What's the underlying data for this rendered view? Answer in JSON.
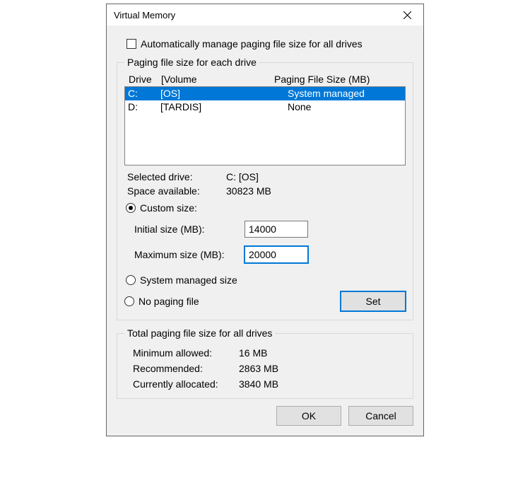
{
  "window": {
    "title": "Virtual Memory"
  },
  "autoManage": {
    "label": "Automatically manage paging file size for all drives",
    "checked": false
  },
  "driveGroup": {
    "legend": "Paging file size for each drive",
    "headers": {
      "drive": "Drive",
      "volume": "[Volume",
      "pfs": "Paging File Size (MB)"
    },
    "rows": [
      {
        "drive": "C:",
        "volume": "[OS]",
        "pfs": "System managed",
        "selected": true
      },
      {
        "drive": "D:",
        "volume": "[TARDIS]",
        "pfs": "None",
        "selected": false
      }
    ],
    "selectedDrive": {
      "label": "Selected drive:",
      "value": "C:  [OS]"
    },
    "spaceAvailable": {
      "label": "Space available:",
      "value": "30823 MB"
    },
    "sizeMode": {
      "custom": {
        "label": "Custom size:",
        "checked": true
      },
      "sysMgd": {
        "label": "System managed size",
        "checked": false
      },
      "noPaging": {
        "label": "No paging file",
        "checked": false
      }
    },
    "initialSize": {
      "label": "Initial size (MB):",
      "value": "14000"
    },
    "maximumSize": {
      "label": "Maximum size (MB):",
      "value": "20000"
    },
    "setButton": "Set"
  },
  "totals": {
    "legend": "Total paging file size for all drives",
    "minAllowed": {
      "label": "Minimum allowed:",
      "value": "16 MB"
    },
    "recommended": {
      "label": "Recommended:",
      "value": "2863 MB"
    },
    "current": {
      "label": "Currently allocated:",
      "value": "3840 MB"
    }
  },
  "buttons": {
    "ok": "OK",
    "cancel": "Cancel"
  }
}
